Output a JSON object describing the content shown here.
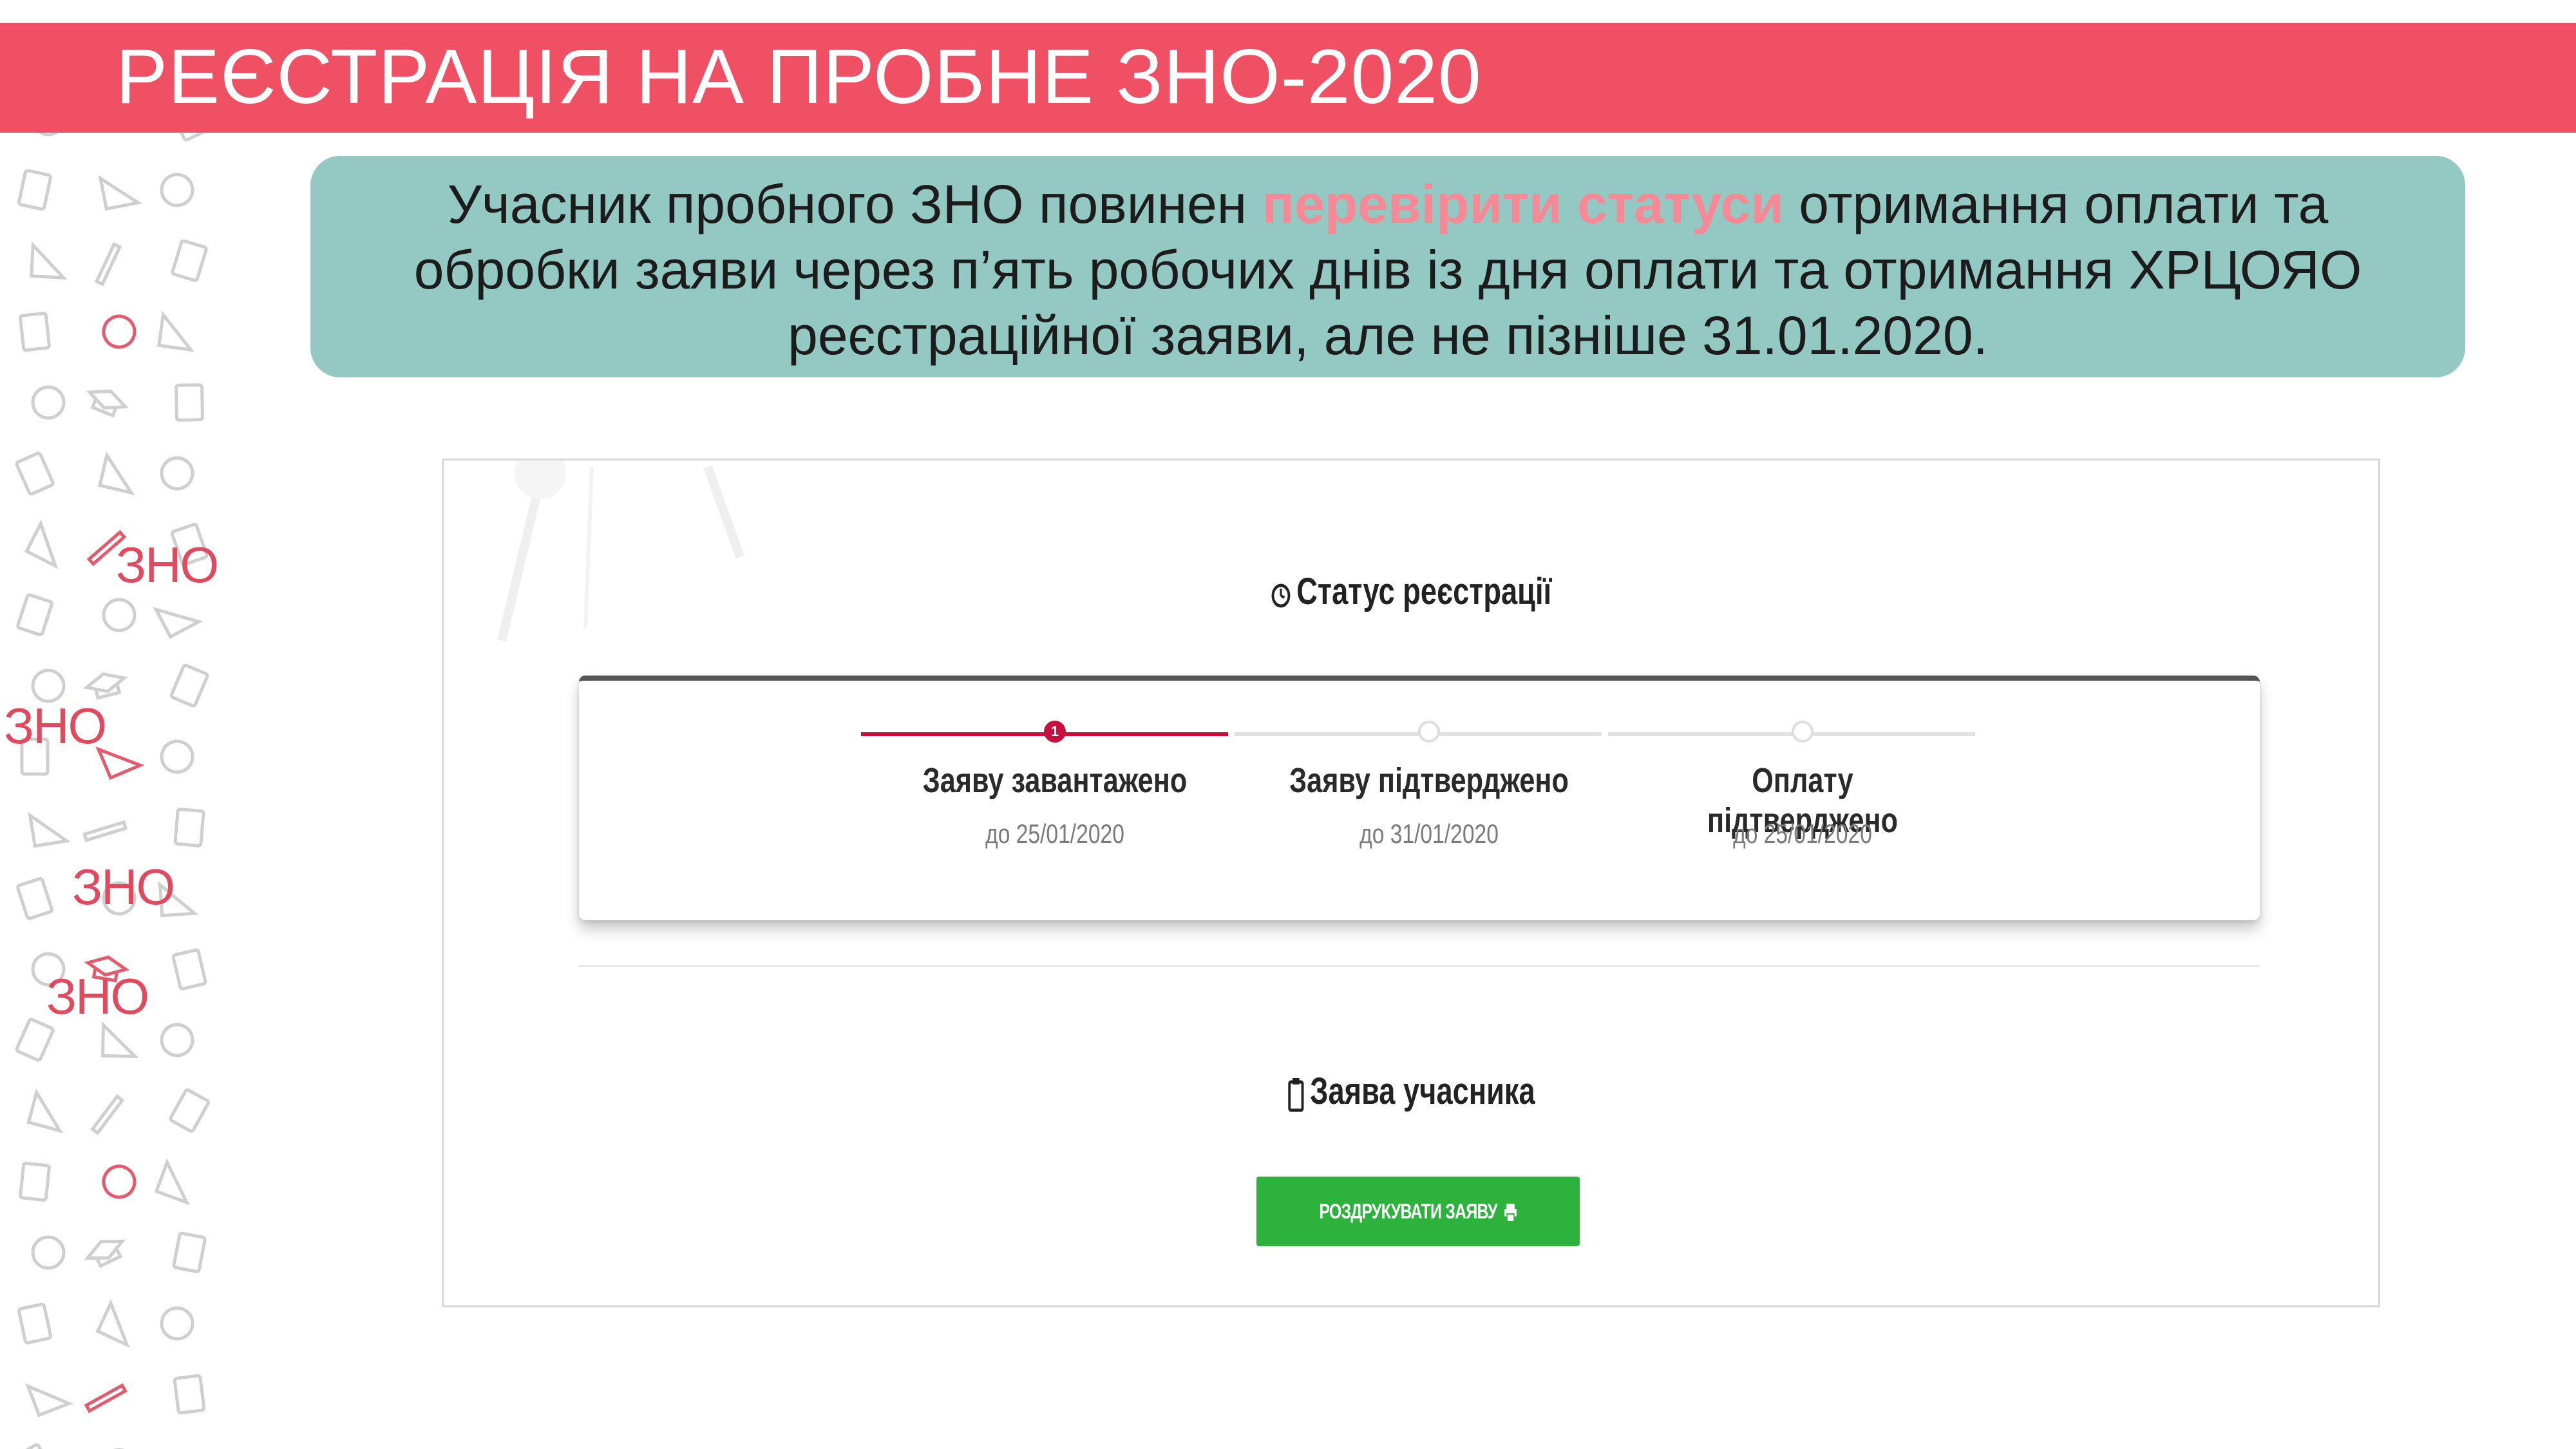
{
  "header": {
    "title": "РЕЄСТРАЦІЯ НА ПРОБНЕ ЗНО-2020"
  },
  "callout": {
    "line1_pre": "Учасник пробного ЗНО повинен ",
    "line1_highlight": "перевірити статуси",
    "line1_post": " отримання оплати та",
    "line2": "обробки заяви через п’ять робочих днів із дня оплати та отримання ХРЦОЯО",
    "line3": "реєстраційної заяви, але не пізніше 31.01.2020."
  },
  "decor": {
    "zno_tags": [
      "ЗНО",
      "ЗНО",
      "ЗНО",
      "ЗНО"
    ]
  },
  "status_section": {
    "title": "Статус реєстрації",
    "steps": [
      {
        "label": "Заяву завантажено",
        "date": "до 25/01/2020",
        "state": "active",
        "number": "1"
      },
      {
        "label": "Заяву підтверджено",
        "date": "до 31/01/2020",
        "state": "pending"
      },
      {
        "label": "Оплату підтверджено",
        "date": "до 25/01/2020",
        "state": "pending"
      }
    ]
  },
  "application_section": {
    "title": "Заява учасника",
    "print_button": "РОЗДРУКУВАТИ ЗАЯВУ"
  },
  "colors": {
    "header": "#f05064",
    "callout": "#93c8c3",
    "highlight": "#f58a96",
    "active_step": "#c8103e",
    "button": "#2db23e"
  }
}
